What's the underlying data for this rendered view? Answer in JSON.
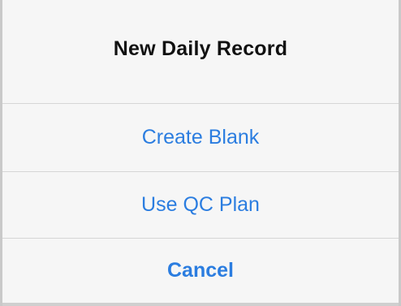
{
  "dialog": {
    "title": "New Daily Record",
    "actions": [
      {
        "label": "Create Blank"
      },
      {
        "label": "Use QC Plan"
      },
      {
        "label": "Cancel"
      }
    ]
  },
  "colors": {
    "accent": "#2b7de0",
    "title": "#111111",
    "background": "#f6f6f6",
    "divider": "#d6d6d6"
  }
}
